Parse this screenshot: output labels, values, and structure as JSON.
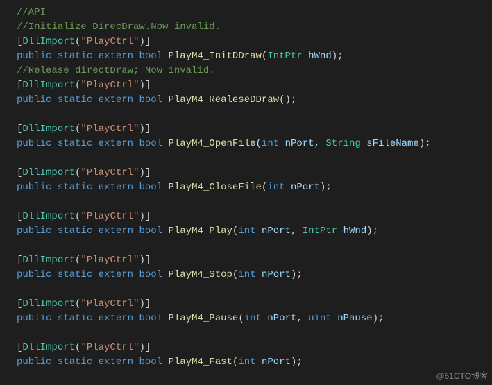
{
  "watermark": "@51CTO博客",
  "tokens": {
    "dllImport": "DllImport",
    "dllName": "\"PlayCtrl\"",
    "public": "public",
    "static": "static",
    "extern": "extern",
    "bool": "bool",
    "int": "int",
    "uint": "uint",
    "IntPtr": "IntPtr",
    "String": "String"
  },
  "lines": [
    {
      "type": "comment",
      "text": "//API"
    },
    {
      "type": "comment",
      "text": "//Initialize DirecDraw.Now invalid."
    },
    {
      "type": "attr"
    },
    {
      "type": "decl",
      "method": "PlayM4_InitDDraw",
      "params": [
        {
          "t": "IntPtr",
          "n": "hWnd"
        }
      ]
    },
    {
      "type": "comment",
      "text": "//Release directDraw; Now invalid."
    },
    {
      "type": "attr"
    },
    {
      "type": "decl",
      "method": "PlayM4_RealeseDDraw",
      "params": []
    },
    {
      "type": "blank"
    },
    {
      "type": "attr"
    },
    {
      "type": "decl",
      "method": "PlayM4_OpenFile",
      "params": [
        {
          "t": "int",
          "n": "nPort"
        },
        {
          "t": "String",
          "n": "sFileName"
        }
      ]
    },
    {
      "type": "blank"
    },
    {
      "type": "attr"
    },
    {
      "type": "decl",
      "method": "PlayM4_CloseFile",
      "params": [
        {
          "t": "int",
          "n": "nPort"
        }
      ]
    },
    {
      "type": "blank"
    },
    {
      "type": "attr"
    },
    {
      "type": "decl",
      "method": "PlayM4_Play",
      "params": [
        {
          "t": "int",
          "n": "nPort"
        },
        {
          "t": "IntPtr",
          "n": "hWnd"
        }
      ]
    },
    {
      "type": "blank"
    },
    {
      "type": "attr"
    },
    {
      "type": "decl",
      "method": "PlayM4_Stop",
      "params": [
        {
          "t": "int",
          "n": "nPort"
        }
      ]
    },
    {
      "type": "blank"
    },
    {
      "type": "attr"
    },
    {
      "type": "decl",
      "method": "PlayM4_Pause",
      "params": [
        {
          "t": "int",
          "n": "nPort"
        },
        {
          "t": "uint",
          "n": "nPause"
        }
      ]
    },
    {
      "type": "blank"
    },
    {
      "type": "attr"
    },
    {
      "type": "decl",
      "method": "PlayM4_Fast",
      "params": [
        {
          "t": "int",
          "n": "nPort"
        }
      ]
    }
  ]
}
